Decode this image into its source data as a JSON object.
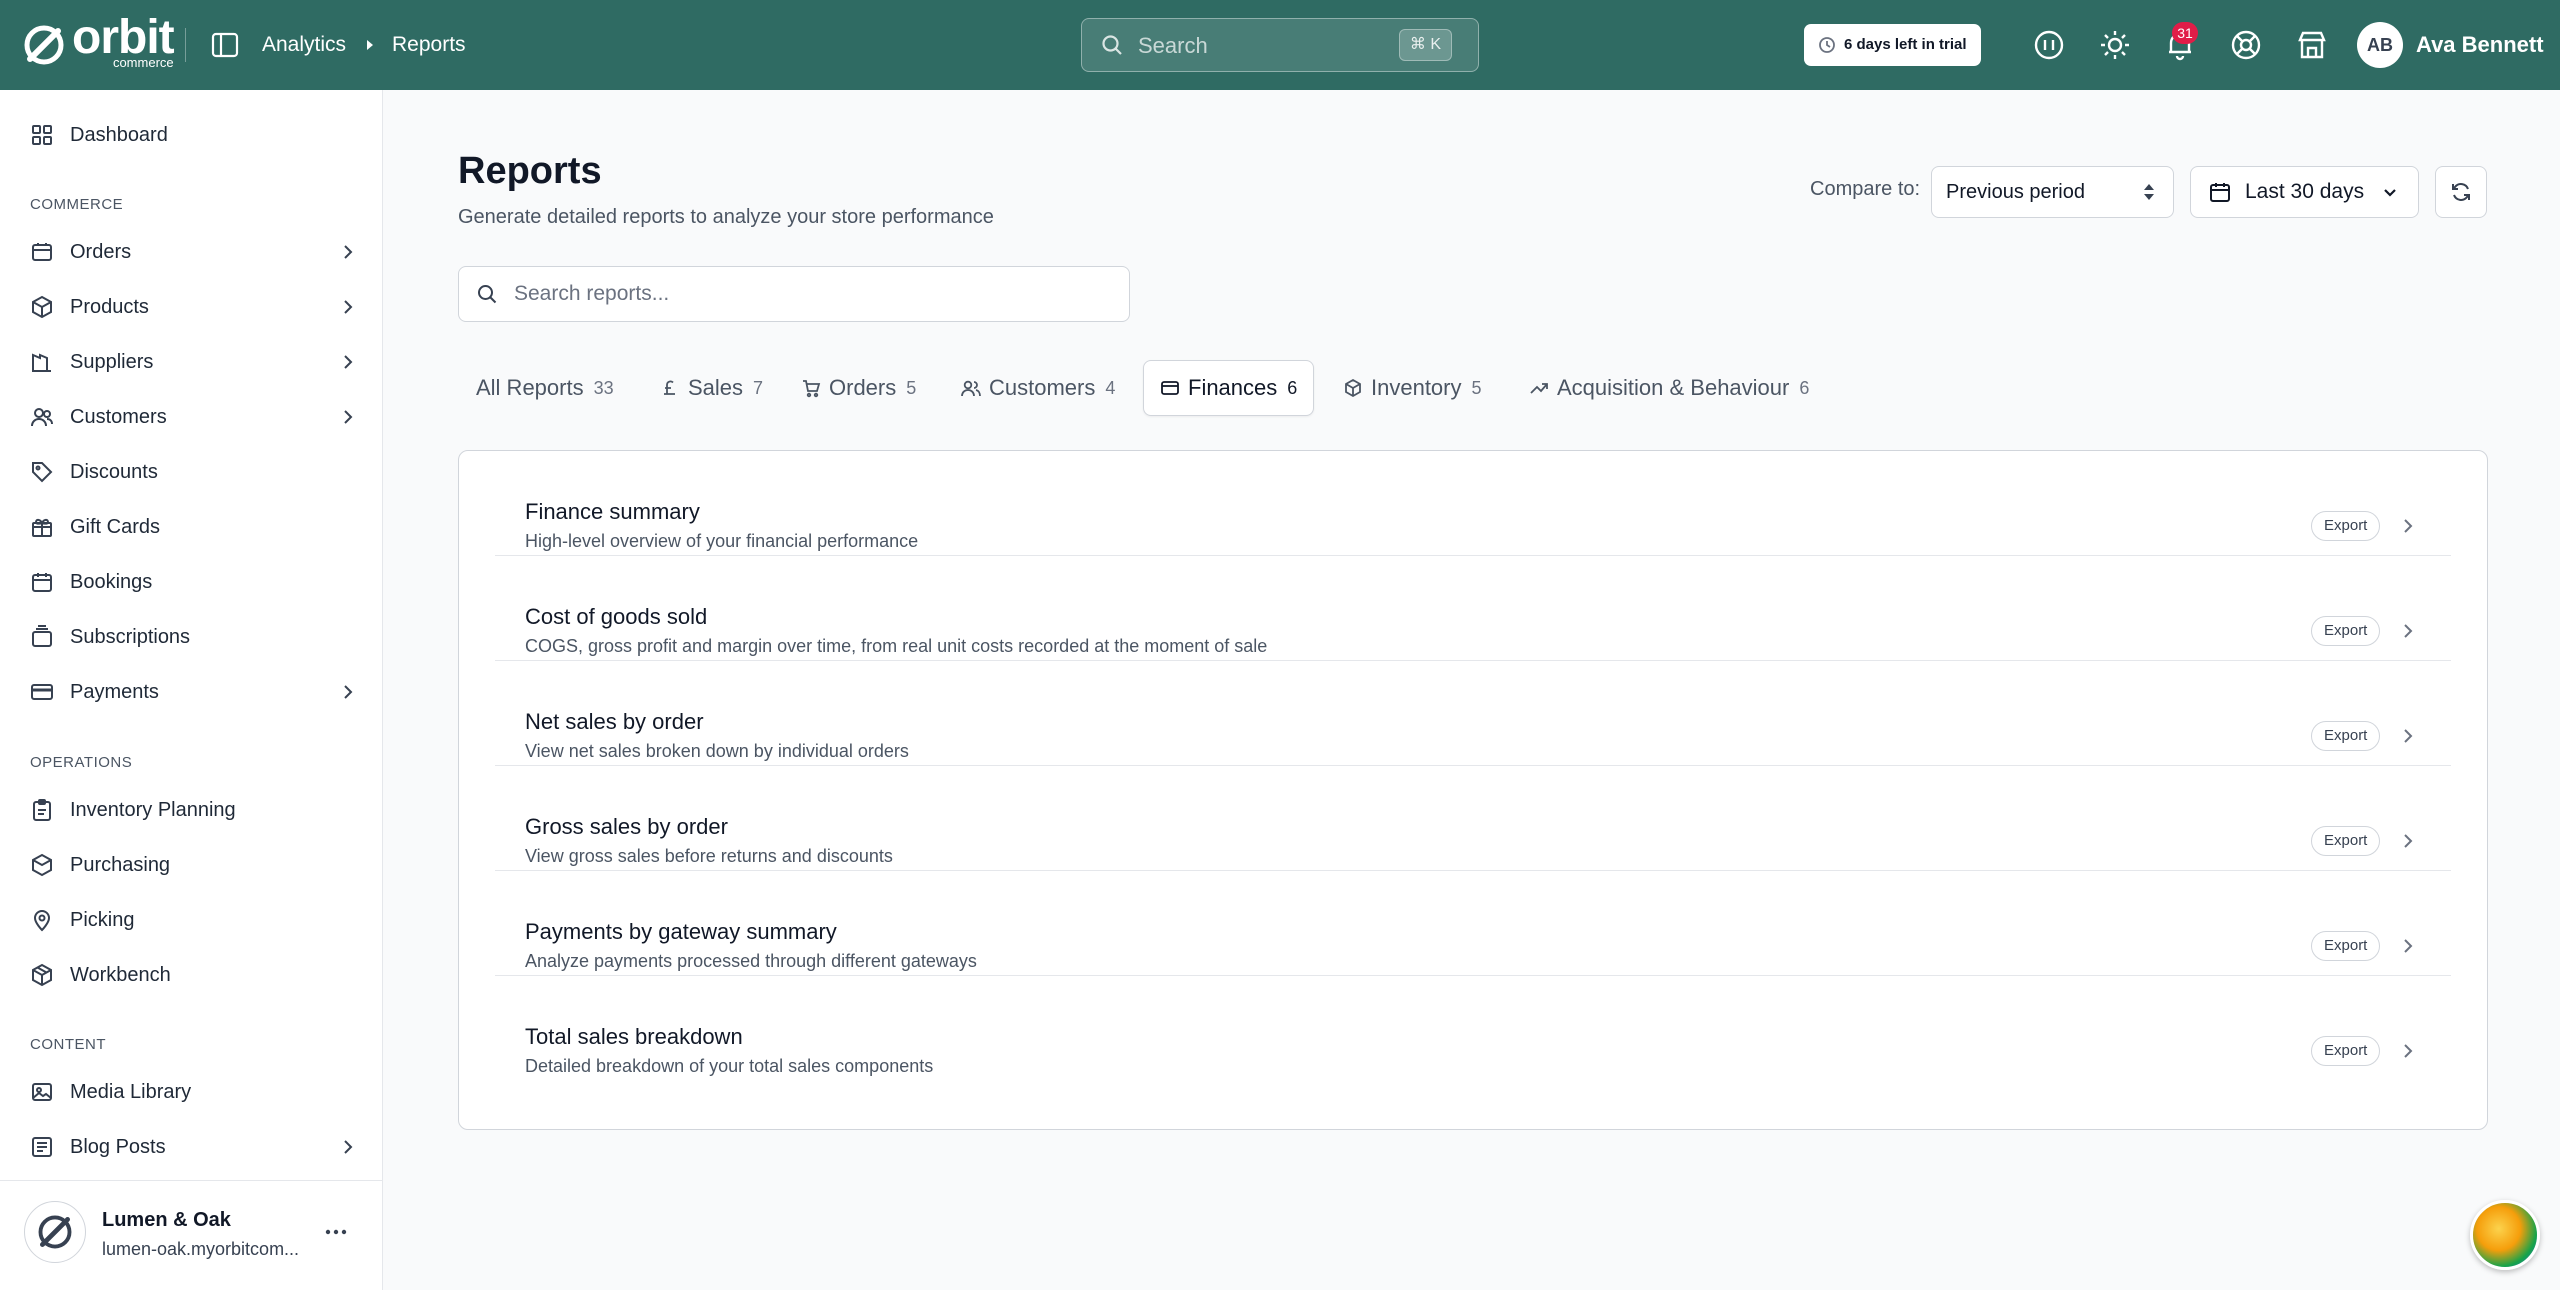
{
  "brand": {
    "name": "orbit",
    "sub": "commerce"
  },
  "breadcrumb": [
    "Analytics",
    "Reports"
  ],
  "top_search": {
    "placeholder": "Search",
    "shortcut": "⌘ K"
  },
  "trial": "6 days left in trial",
  "notifications_count": "31",
  "user": {
    "initials": "AB",
    "name": "Ava Bennett"
  },
  "sidebar": {
    "top": [
      {
        "label": "Dashboard",
        "icon": "dashboard-icon"
      }
    ],
    "sections": [
      {
        "title": "COMMERCE",
        "items": [
          {
            "label": "Orders",
            "icon": "orders-icon",
            "expandable": true
          },
          {
            "label": "Products",
            "icon": "products-icon",
            "expandable": true
          },
          {
            "label": "Suppliers",
            "icon": "suppliers-icon",
            "expandable": true
          },
          {
            "label": "Customers",
            "icon": "customers-icon",
            "expandable": true
          },
          {
            "label": "Discounts",
            "icon": "tag-icon",
            "expandable": false
          },
          {
            "label": "Gift Cards",
            "icon": "gift-icon",
            "expandable": false
          },
          {
            "label": "Bookings",
            "icon": "calendar-icon",
            "expandable": false
          },
          {
            "label": "Subscriptions",
            "icon": "subscriptions-icon",
            "expandable": false
          },
          {
            "label": "Payments",
            "icon": "card-icon",
            "expandable": true
          }
        ]
      },
      {
        "title": "OPERATIONS",
        "items": [
          {
            "label": "Inventory Planning",
            "icon": "clipboard-icon",
            "expandable": false
          },
          {
            "label": "Purchasing",
            "icon": "purchasing-icon",
            "expandable": false
          },
          {
            "label": "Picking",
            "icon": "location-icon",
            "expandable": false
          },
          {
            "label": "Workbench",
            "icon": "box-icon",
            "expandable": false
          }
        ]
      },
      {
        "title": "CONTENT",
        "items": [
          {
            "label": "Media Library",
            "icon": "image-icon",
            "expandable": false
          },
          {
            "label": "Blog Posts",
            "icon": "blog-icon",
            "expandable": true
          }
        ]
      }
    ],
    "store": {
      "name": "Lumen & Oak",
      "url": "lumen-oak.myorbitcom..."
    }
  },
  "page": {
    "title": "Reports",
    "subtitle": "Generate detailed reports to analyze your store performance",
    "compare_label": "Compare to:",
    "compare_value": "Previous period",
    "range_value": "Last 30 days",
    "search_placeholder": "Search reports..."
  },
  "tabs": [
    {
      "label": "All Reports",
      "count": "33",
      "icon": ""
    },
    {
      "label": "Sales",
      "count": "7",
      "icon": "pound-icon"
    },
    {
      "label": "Orders",
      "count": "5",
      "icon": "cart-icon"
    },
    {
      "label": "Customers",
      "count": "4",
      "icon": "users-icon"
    },
    {
      "label": "Finances",
      "count": "6",
      "icon": "card-icon",
      "active": true
    },
    {
      "label": "Inventory",
      "count": "5",
      "icon": "box-icon"
    },
    {
      "label": "Acquisition & Behaviour",
      "count": "6",
      "icon": "trending-icon"
    }
  ],
  "reports": [
    {
      "title": "Finance summary",
      "desc": "High-level overview of your financial performance",
      "action": "Export"
    },
    {
      "title": "Cost of goods sold",
      "desc": "COGS, gross profit and margin over time, from real unit costs recorded at the moment of sale",
      "action": "Export"
    },
    {
      "title": "Net sales by order",
      "desc": "View net sales broken down by individual orders",
      "action": "Export"
    },
    {
      "title": "Gross sales by order",
      "desc": "View gross sales before returns and discounts",
      "action": "Export"
    },
    {
      "title": "Payments by gateway summary",
      "desc": "Analyze payments processed through different gateways",
      "action": "Export"
    },
    {
      "title": "Total sales breakdown",
      "desc": "Detailed breakdown of your total sales components",
      "action": "Export"
    }
  ],
  "colors": {
    "topbar": "#2f6b63",
    "badge": "#e11d48"
  }
}
